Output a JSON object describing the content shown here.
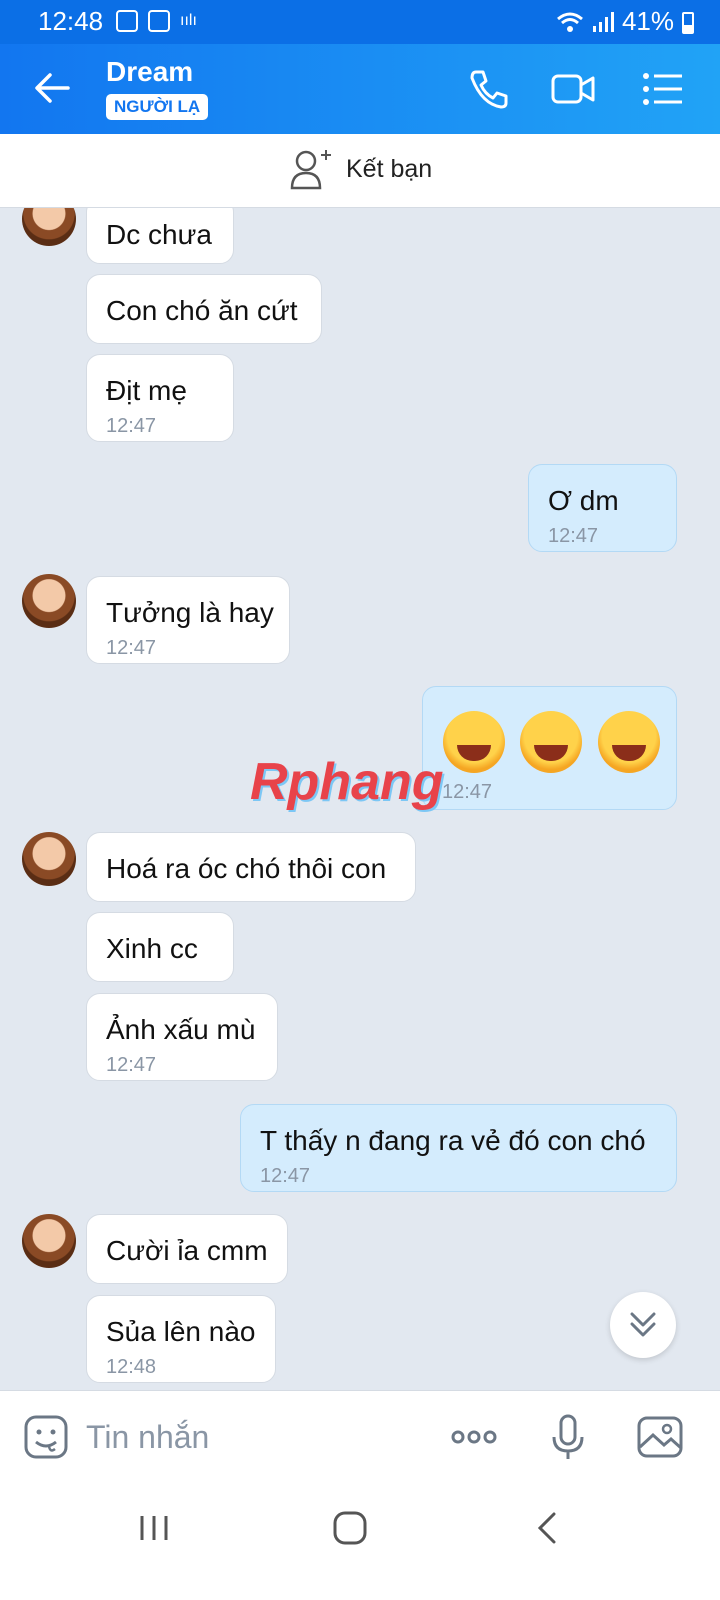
{
  "status": {
    "time": "12:48",
    "battery": "41%"
  },
  "header": {
    "title": "Dream",
    "badge": "NGƯỜI LẠ"
  },
  "friend_bar": {
    "label": "Kết bạn"
  },
  "messages": [
    {
      "text": "Dc chưa"
    },
    {
      "text": "Con chó ăn cứt"
    },
    {
      "text": "Địt mẹ",
      "time": "12:47"
    },
    {
      "text": "Ơ dm",
      "time": "12:47"
    },
    {
      "text": "Tưởng là hay",
      "time": "12:47"
    },
    {
      "emoji": "face-with-tears-of-joy x3",
      "time": "12:47"
    },
    {
      "text": "Hoá ra óc chó thôi con"
    },
    {
      "text": "Xinh cc"
    },
    {
      "text": "Ảnh xấu mù",
      "time": "12:47"
    },
    {
      "text": "T thấy n đang ra vẻ đó con chó",
      "time": "12:47"
    },
    {
      "text": "Cười ỉa cmm"
    },
    {
      "text": "Sủa lên nào",
      "time": "12:48"
    }
  ],
  "watermark": "Rphang",
  "input": {
    "placeholder": "Tin nhắn"
  },
  "colors": {
    "header_start": "#1276f0",
    "header_end": "#21a3f6",
    "bubble_out": "#d4ecfd",
    "bubble_in": "#ffffff",
    "background": "#e2e8f0"
  }
}
